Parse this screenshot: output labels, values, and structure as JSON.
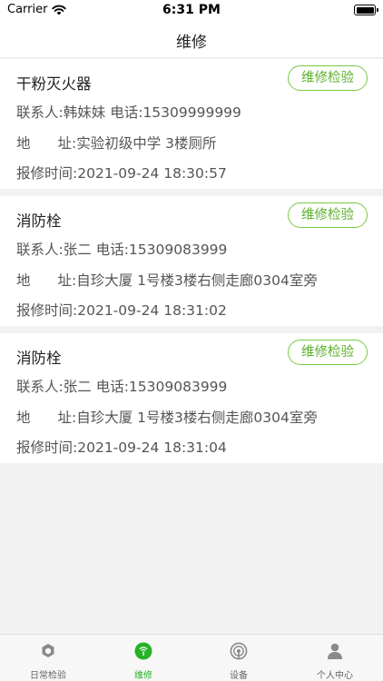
{
  "status_bar": {
    "carrier": "Carrier",
    "time": "6:31 PM"
  },
  "nav": {
    "title": "维修"
  },
  "labels": {
    "contact": "联系人:",
    "phone": "电话:",
    "address_a": "地",
    "address_b": "址:",
    "report_time": "报修时间:"
  },
  "records": [
    {
      "title": "干粉灭火器",
      "action": "维修检验",
      "contact": "韩妹妹",
      "phone": "15309999999",
      "address": "实验初级中学 3楼厕所",
      "report_time": "2021-09-24 18:30:57"
    },
    {
      "title": "消防栓",
      "action": "维修检验",
      "contact": "张二",
      "phone": "15309083999",
      "address": "自珍大厦 1号楼3楼右侧走廊0304室旁",
      "report_time": "2021-09-24 18:31:02"
    },
    {
      "title": "消防栓",
      "action": "维修检验",
      "contact": "张二",
      "phone": "15309083999",
      "address": "自珍大厦 1号楼3楼右侧走廊0304室旁",
      "report_time": "2021-09-24 18:31:04"
    }
  ],
  "tabs": [
    {
      "label": "日常检验",
      "icon": "shield-hexagon-icon"
    },
    {
      "label": "维修",
      "icon": "repair-circle-icon",
      "active": true
    },
    {
      "label": "设备",
      "icon": "device-signal-icon"
    },
    {
      "label": "个人中心",
      "icon": "person-icon"
    }
  ],
  "colors": {
    "accent": "#27b327",
    "button_border": "#7ac943",
    "background": "#f2f2f2"
  }
}
